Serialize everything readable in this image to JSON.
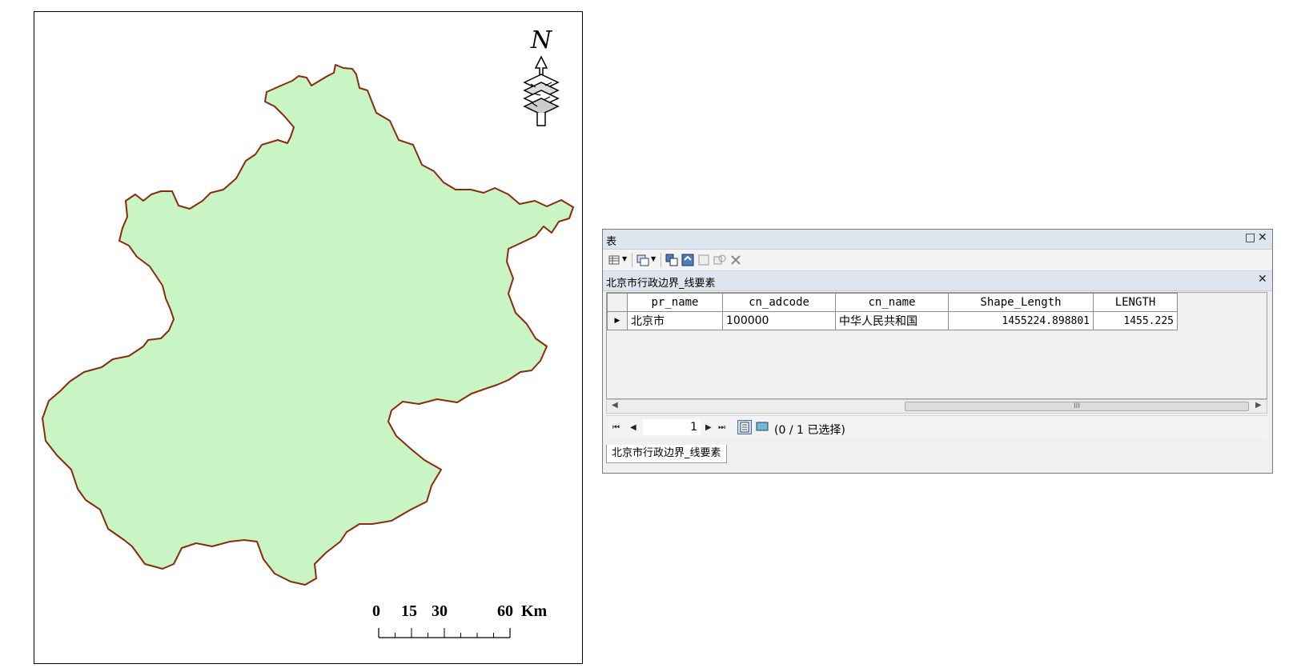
{
  "map": {
    "north_label": "N",
    "scale_labels": [
      "0",
      "15",
      "30",
      "60"
    ],
    "scale_unit": "Km",
    "fill_color": "#c9f4c4",
    "outline_color": "#8b2a0c"
  },
  "table_window": {
    "title": "表",
    "restore_icon": "restore-icon",
    "close_icon": "close-icon",
    "layer_tab_title": "北京市行政边界_线要素",
    "columns": [
      "pr_name",
      "cn_adcode",
      "cn_name",
      "Shape_Length",
      "LENGTH"
    ],
    "rows": [
      [
        "北京市",
        "100000",
        "中华人民共和国",
        "1455224.898801",
        "1455.225"
      ]
    ],
    "scroll_thumb_label": "III",
    "nav": {
      "current_page": "1",
      "selection_status": "(0 / 1 已选择)"
    },
    "bottom_tab": "北京市行政边界_线要素"
  }
}
